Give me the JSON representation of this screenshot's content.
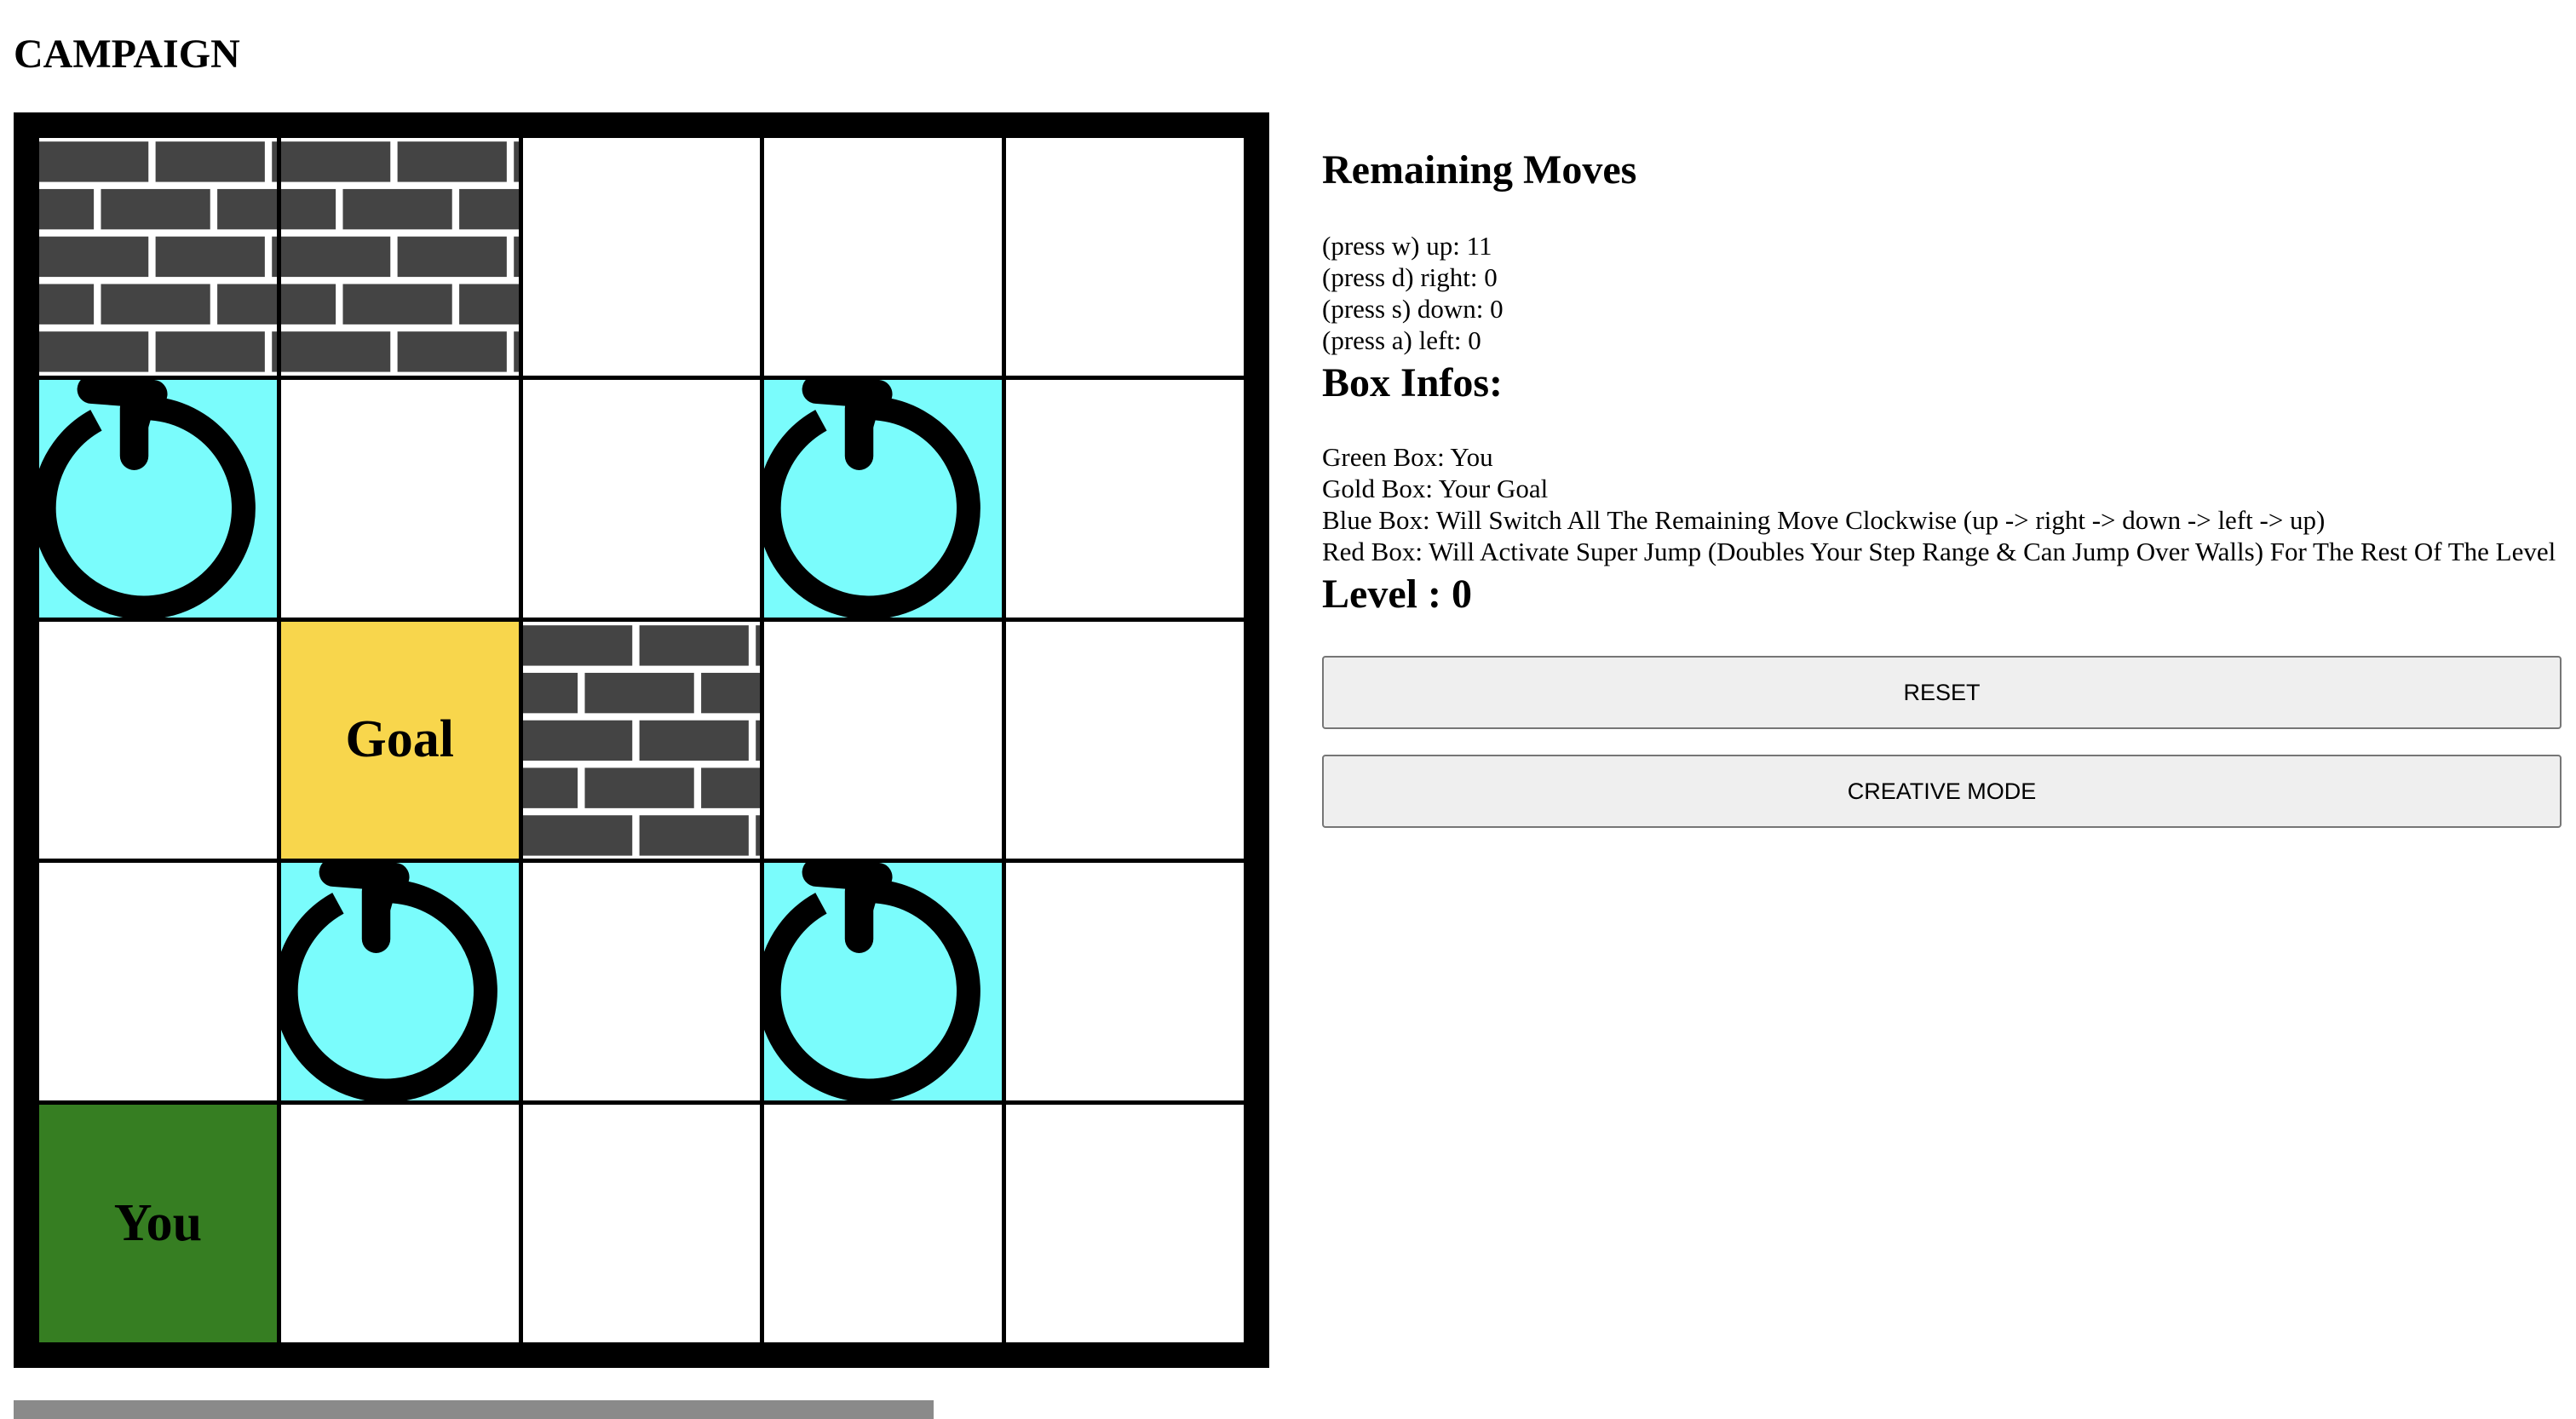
{
  "title": "CAMPAIGN",
  "board": {
    "cells": [
      [
        "wall",
        "wall",
        "empty",
        "empty",
        "empty"
      ],
      [
        "blue",
        "empty",
        "empty",
        "blue",
        "empty"
      ],
      [
        "empty",
        "gold",
        "wall",
        "empty",
        "empty"
      ],
      [
        "empty",
        "blue",
        "empty",
        "blue",
        "empty"
      ],
      [
        "green",
        "empty",
        "empty",
        "empty",
        "empty"
      ]
    ],
    "goal_label": "Goal",
    "player_label": "You",
    "colors": {
      "blue": "#7afcfc",
      "gold": "#f8d64c",
      "green": "#367e22",
      "wall": "#444444",
      "grid": "#000000"
    }
  },
  "remaining_moves": {
    "heading": "Remaining Moves",
    "lines": [
      "(press w) up: 11",
      "(press d) right: 0",
      "(press s) down: 0",
      "(press a) left: 0"
    ]
  },
  "box_infos": {
    "heading": "Box Infos:",
    "lines": [
      "Green Box: You",
      "Gold Box: Your Goal",
      "Blue Box: Will Switch All The Remaining Move Clockwise (up -> right -> down -> left -> up)",
      "Red Box: Will Activate Super Jump (Doubles Your Step Range & Can Jump Over Walls) For The Rest Of The Level"
    ]
  },
  "level": {
    "text": "Level : 0"
  },
  "buttons": {
    "reset": "RESET",
    "creative": "CREATIVE MODE"
  }
}
